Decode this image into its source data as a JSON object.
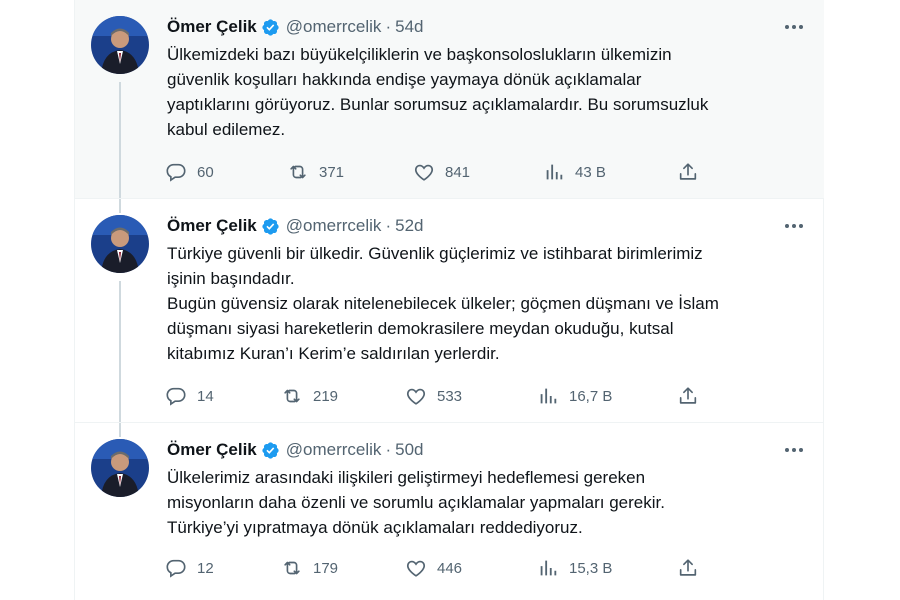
{
  "tweets": [
    {
      "author": "Ömer Çelik",
      "handle": "@omerrcelik",
      "separator": "·",
      "time": "54d",
      "lines": [
        "Ülkemizdeki bazı büyükelçiliklerin ve başkonsoloslukların ülkemizin",
        "güvenlik koşulları hakkında endişe yaymaya dönük açıklamalar",
        "yaptıklarını görüyoruz. Bunlar sorumsuz açıklamalardır. Bu sorumsuzluk",
        "kabul edilemez."
      ],
      "replies": "60",
      "retweets": "371",
      "likes": "841",
      "views": "43 B"
    },
    {
      "author": "Ömer Çelik",
      "handle": "@omerrcelik",
      "separator": "·",
      "time": "52d",
      "lines": [
        "Türkiye güvenli bir ülkedir. Güvenlik güçlerimiz ve istihbarat birimlerimiz",
        "işinin başındadır.",
        "Bugün güvensiz olarak nitelenebilecek ülkeler; göçmen düşmanı ve İslam",
        "düşmanı siyasi hareketlerin demokrasilere meydan okuduğu, kutsal",
        "kitabımız Kuran’ı Kerim’e saldırılan yerlerdir."
      ],
      "replies": "14",
      "retweets": "219",
      "likes": "533",
      "views": "16,7 B"
    },
    {
      "author": "Ömer Çelik",
      "handle": "@omerrcelik",
      "separator": "·",
      "time": "50d",
      "lines": [
        "Ülkelerimiz arasındaki ilişkileri geliştirmeyi hedeflemesi gereken",
        "misyonların daha özenli ve sorumlu açıklamalar yapmaları gerekir.",
        "Türkiye’yi yıpratmaya dönük açıklamaları reddediyoruz."
      ],
      "replies": "12",
      "retweets": "179",
      "likes": "446",
      "views": "15,3 B"
    }
  ],
  "colors": {
    "verified": "#1d9bf0",
    "secondary_text": "#536471",
    "highlight_bg": "#f7f9f9",
    "thread_line": "#cfd9de"
  },
  "icons": {
    "reply": "reply-icon",
    "retweet": "retweet-icon",
    "like": "like-icon",
    "views": "views-icon",
    "share": "share-icon",
    "more": "more-icon",
    "verified": "verified-badge-icon"
  }
}
